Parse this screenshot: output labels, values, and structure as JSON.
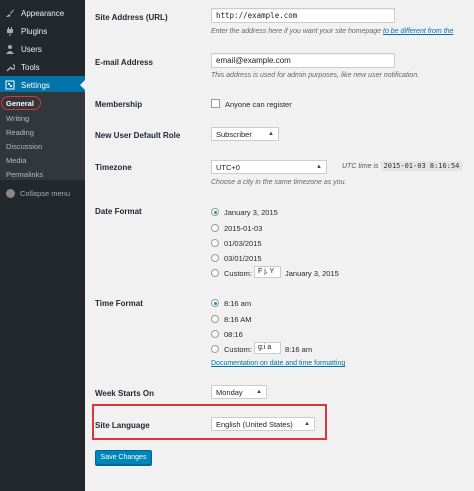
{
  "sidebar": {
    "menu": [
      {
        "label": "Appearance",
        "icon": "brush-icon"
      },
      {
        "label": "Plugins",
        "icon": "plug-icon"
      },
      {
        "label": "Users",
        "icon": "users-icon"
      },
      {
        "label": "Tools",
        "icon": "wrench-icon"
      },
      {
        "label": "Settings",
        "icon": "settings-icon"
      }
    ],
    "submenu": [
      "General",
      "Writing",
      "Reading",
      "Discussion",
      "Media",
      "Permalinks"
    ],
    "collapse_label": "Collapse menu"
  },
  "form": {
    "site_address": {
      "label": "Site Address (URL)",
      "value": "http://example.com",
      "desc": "Enter the address here if you want your site homepage",
      "desc_link": "to be different from the"
    },
    "email": {
      "label": "E-mail Address",
      "value": "email@example.com",
      "desc": "This address is used for admin purposes, like new user notification."
    },
    "membership": {
      "label": "Membership",
      "checkbox_label": "Anyone can register"
    },
    "default_role": {
      "label": "New User Default Role",
      "selected": "Subscriber"
    },
    "timezone": {
      "label": "Timezone",
      "selected": "UTC+0",
      "utc_label": "UTC time is",
      "utc_value": "2015-01-03 8:16:54",
      "desc": "Choose a city in the same timezone as you."
    },
    "date_format": {
      "label": "Date Format",
      "options": [
        "January 3, 2015",
        "2015-01-03",
        "01/03/2015",
        "03/01/2015"
      ],
      "custom_label": "Custom:",
      "custom_value": "F j, Y",
      "custom_preview": "January 3, 2015"
    },
    "time_format": {
      "label": "Time Format",
      "options": [
        "8:16 am",
        "8:16 AM",
        "08:16"
      ],
      "custom_label": "Custom:",
      "custom_value": "g:i a",
      "custom_preview": "8:16 am",
      "doc_link": "Documentation on date and time formatting"
    },
    "week_starts": {
      "label": "Week Starts On",
      "selected": "Monday"
    },
    "site_language": {
      "label": "Site Language",
      "selected": "English (United States)"
    },
    "save_label": "Save Changes"
  },
  "colors": {
    "sidebar_bg": "#23282d",
    "active_blue": "#0073aa",
    "highlight_red": "#d9363b",
    "button_blue": "#0085ba"
  }
}
